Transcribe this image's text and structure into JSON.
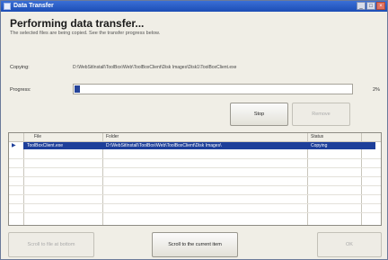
{
  "window": {
    "title": "Data Transfer"
  },
  "header": {
    "title": "Performing data transfer...",
    "subtitle": "The selected files are being copied. See the transfer progress below."
  },
  "copying": {
    "label": "Copying:",
    "path": "D:\\WebSitInstall\\ToolBox\\Web\\ToolBoxClient\\Disk Images\\Disk1\\ToolBoxClient.exe"
  },
  "progress": {
    "label": "Progress:",
    "percent_text": "2%",
    "fraction": 0.02
  },
  "buttons": {
    "stop": "Stop",
    "remove": "Remove",
    "scroll_all": "Scroll to file at bottom",
    "scroll_current": "Scroll to the current item",
    "ok": "OK"
  },
  "table": {
    "columns": [
      "File",
      "Folder",
      "Status"
    ],
    "rows": [
      {
        "file": "ToolBoxClient.exe",
        "folder": "D:\\WebSitInstall\\ToolBox\\Web\\ToolBoxClient\\Disk Images\\",
        "status": "Copying"
      }
    ]
  },
  "colors": {
    "accent": "#1d3f9a",
    "progress_fill": "#26449a",
    "title_bar": "#2458c8"
  },
  "icons": {
    "app": "app-icon",
    "row_marker": "arrow-right-icon"
  }
}
